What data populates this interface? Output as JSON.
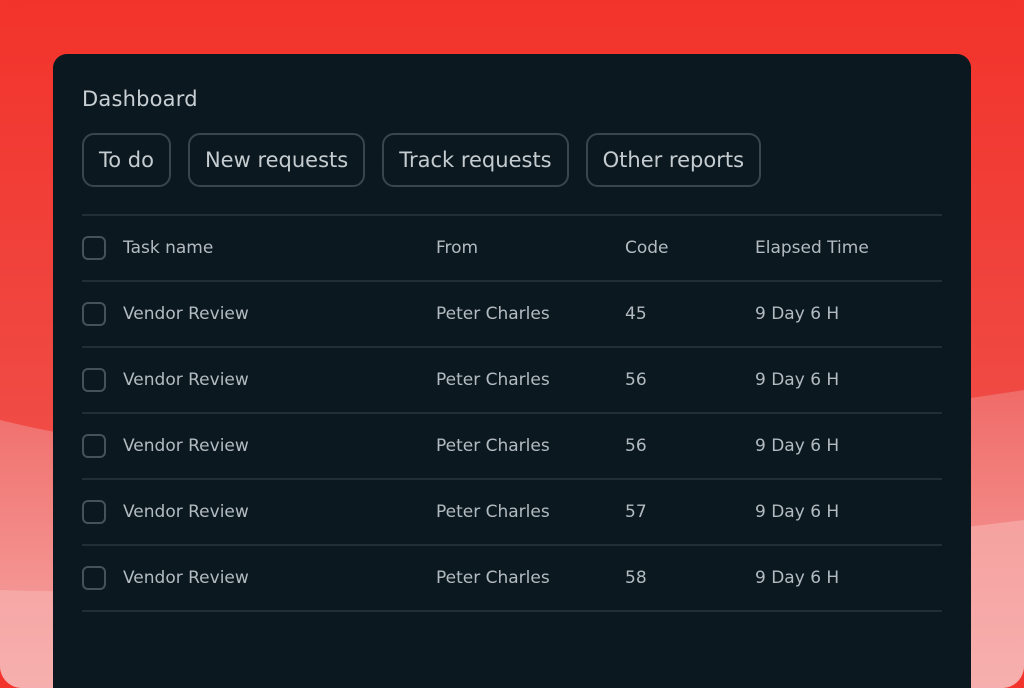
{
  "dashboard": {
    "title": "Dashboard",
    "tabs": [
      "To do",
      "New requests",
      "Track requests",
      "Other reports"
    ]
  },
  "table": {
    "columns": {
      "task": "Task name",
      "from": "From",
      "code": "Code",
      "time": "Elapsed Time"
    },
    "rows": [
      {
        "task": "Vendor Review",
        "from": "Peter Charles",
        "code": "45",
        "time": "9 Day 6 H"
      },
      {
        "task": "Vendor Review",
        "from": "Peter Charles",
        "code": "56",
        "time": "9 Day 6 H"
      },
      {
        "task": "Vendor Review",
        "from": "Peter Charles",
        "code": "56",
        "time": "9 Day 6 H"
      },
      {
        "task": "Vendor Review",
        "from": "Peter Charles",
        "code": "57",
        "time": "9 Day 6 H"
      },
      {
        "task": "Vendor Review",
        "from": "Peter Charles",
        "code": "58",
        "time": "9 Day 6 H"
      }
    ]
  },
  "colors": {
    "background_red": "#f2342c",
    "panel": "#0b1820",
    "text": "#c9d0d4",
    "border": "#3a454c"
  }
}
